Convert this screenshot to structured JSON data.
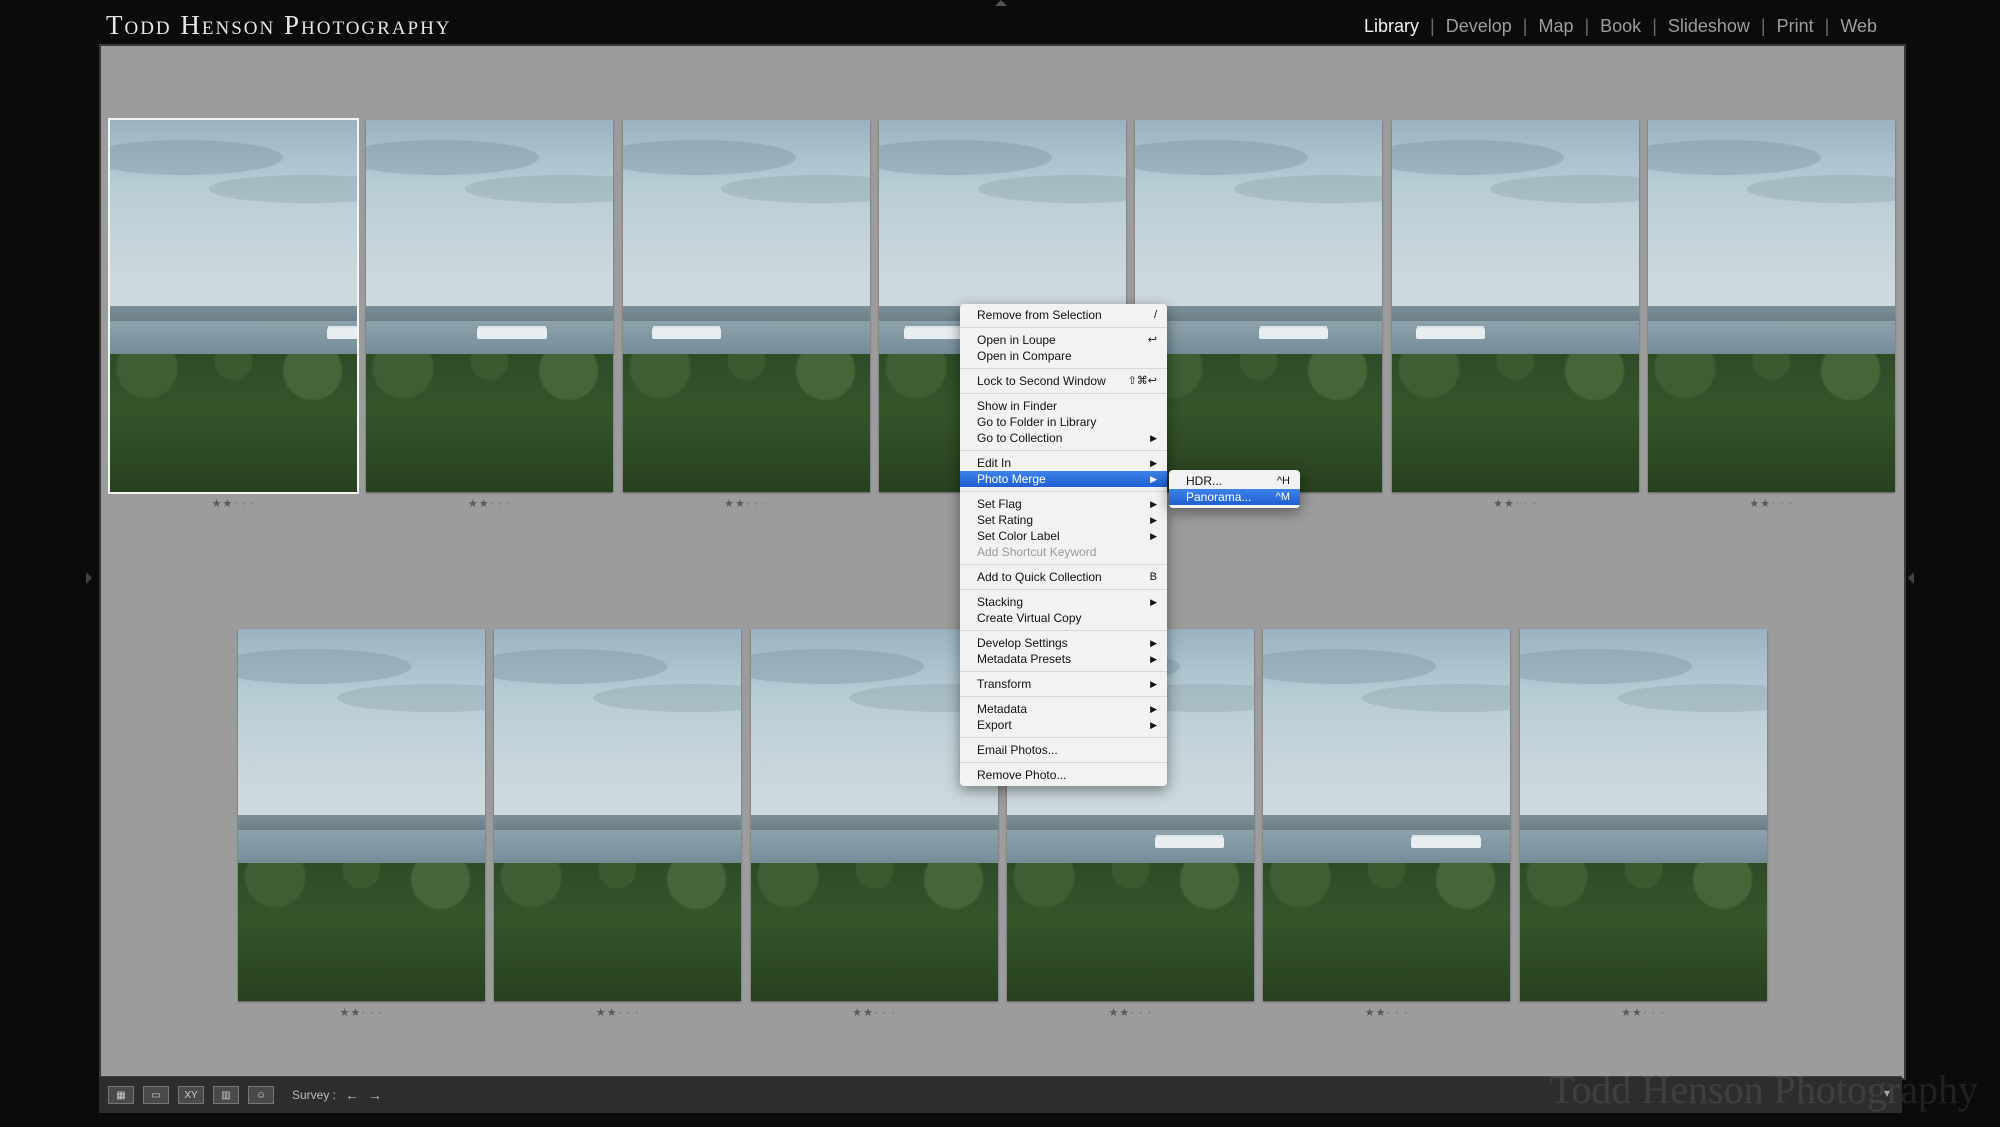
{
  "identity_plate": "Todd Henson Photography",
  "modules": [
    {
      "label": "Library",
      "active": true
    },
    {
      "label": "Develop",
      "active": false
    },
    {
      "label": "Map",
      "active": false
    },
    {
      "label": "Book",
      "active": false
    },
    {
      "label": "Slideshow",
      "active": false
    },
    {
      "label": "Print",
      "active": false
    },
    {
      "label": "Web",
      "active": false
    }
  ],
  "photos_row1": [
    {
      "rating": "★★· · ·",
      "selected": true
    },
    {
      "rating": "★★· · ·"
    },
    {
      "rating": "★★· · ·"
    },
    {
      "rating": "★★· · ·"
    },
    {
      "rating": "★★· · ·"
    },
    {
      "rating": "★★· · ·"
    },
    {
      "rating": "★★· · ·"
    }
  ],
  "photos_row2": [
    {
      "rating": "★★· · ·"
    },
    {
      "rating": "★★· · ·"
    },
    {
      "rating": "★★· · ·"
    },
    {
      "rating": "★★· · ·"
    },
    {
      "rating": "★★· · ·"
    },
    {
      "rating": "★★· · ·"
    }
  ],
  "context_menu": {
    "items": [
      {
        "label": "Remove from Selection",
        "shortcut": "/"
      },
      {
        "sep": true
      },
      {
        "label": "Open in Loupe",
        "shortcut": "↩"
      },
      {
        "label": "Open in Compare"
      },
      {
        "sep": true
      },
      {
        "label": "Lock to Second Window",
        "shortcut": "⇧⌘↩"
      },
      {
        "sep": true
      },
      {
        "label": "Show in Finder"
      },
      {
        "label": "Go to Folder in Library"
      },
      {
        "label": "Go to Collection",
        "submenu": true
      },
      {
        "sep": true
      },
      {
        "label": "Edit In",
        "submenu": true
      },
      {
        "label": "Photo Merge",
        "submenu": true,
        "highlighted": true
      },
      {
        "sep": true
      },
      {
        "label": "Set Flag",
        "submenu": true
      },
      {
        "label": "Set Rating",
        "submenu": true
      },
      {
        "label": "Set Color Label",
        "submenu": true
      },
      {
        "label": "Add Shortcut Keyword",
        "disabled": true
      },
      {
        "sep": true
      },
      {
        "label": "Add to Quick Collection",
        "shortcut": "B"
      },
      {
        "sep": true
      },
      {
        "label": "Stacking",
        "submenu": true
      },
      {
        "label": "Create Virtual Copy"
      },
      {
        "sep": true
      },
      {
        "label": "Develop Settings",
        "submenu": true
      },
      {
        "label": "Metadata Presets",
        "submenu": true
      },
      {
        "sep": true
      },
      {
        "label": "Transform",
        "submenu": true
      },
      {
        "sep": true
      },
      {
        "label": "Metadata",
        "submenu": true
      },
      {
        "label": "Export",
        "submenu": true
      },
      {
        "sep": true
      },
      {
        "label": "Email Photos..."
      },
      {
        "sep": true
      },
      {
        "label": "Remove Photo..."
      }
    ]
  },
  "photo_merge_submenu": [
    {
      "label": "HDR...",
      "shortcut": "^H"
    },
    {
      "label": "Panorama...",
      "shortcut": "^M",
      "highlighted": true
    }
  ],
  "toolbar": {
    "survey_label": "Survey :",
    "prev_arrow": "←",
    "next_arrow": "→",
    "chevron": "▾"
  },
  "watermark": "Todd Henson Photography"
}
